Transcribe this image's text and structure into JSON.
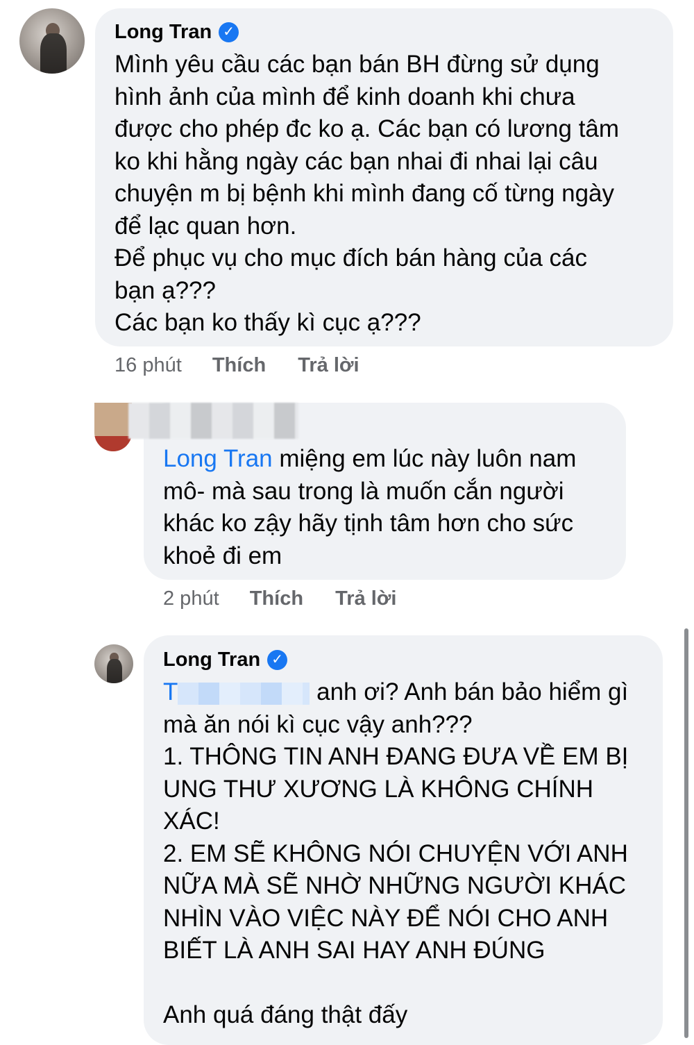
{
  "comment1": {
    "author": "Long Tran",
    "lines": [
      "Mình yêu cầu các bạn bán BH đừng sử dụng",
      "hình ảnh của mình để kinh doanh khi chưa",
      "được cho phép đc ko ạ. Các bạn có lương tâm",
      "ko khi hằng ngày các bạn nhai đi nhai lại câu",
      "chuyện m bị bệnh khi mình đang cố từng ngày",
      "để lạc quan hơn.",
      "Để phục vụ cho mục đích bán hàng của các",
      "bạn ạ???",
      "Các bạn ko thấy kì cục ạ???"
    ],
    "time": "16 phút",
    "like": "Thích",
    "reply": "Trả lời"
  },
  "comment2": {
    "mention": "Long Tran",
    "first_line_rest": " miệng em lúc này luôn nam",
    "lines": [
      "mô- mà sau trong là muốn cắn người",
      "khác ko zậy hãy tịnh tâm hơn cho sức",
      "khoẻ đi em"
    ],
    "time": "2 phút",
    "like": "Thích",
    "reply": "Trả lời"
  },
  "comment3": {
    "author": "Long Tran",
    "mention_initial": "T",
    "first_line_rest": " anh ơi? Anh bán bảo hiểm gì",
    "lines": [
      "mà ăn nói kì cục vậy anh???",
      "1. THÔNG TIN ANH ĐANG ĐƯA VỀ EM BỊ",
      "UNG THƯ XƯƠNG LÀ KHÔNG CHÍNH",
      "XÁC!",
      "2. EM SẼ KHÔNG NÓI CHUYỆN VỚI ANH",
      "NỮA MÀ SẼ NHỜ NHỮNG NGƯỜI KHÁC",
      "NHÌN VÀO VIỆC NÀY ĐỂ NÓI CHO ANH",
      "BIẾT LÀ ANH SAI HAY ANH ĐÚNG",
      "",
      "Anh quá đáng thật đấy"
    ]
  },
  "icons": {
    "verified": "✓"
  },
  "colors": {
    "mention": "#1877f2",
    "bubble": "#f0f2f5",
    "meta": "#65676b"
  }
}
